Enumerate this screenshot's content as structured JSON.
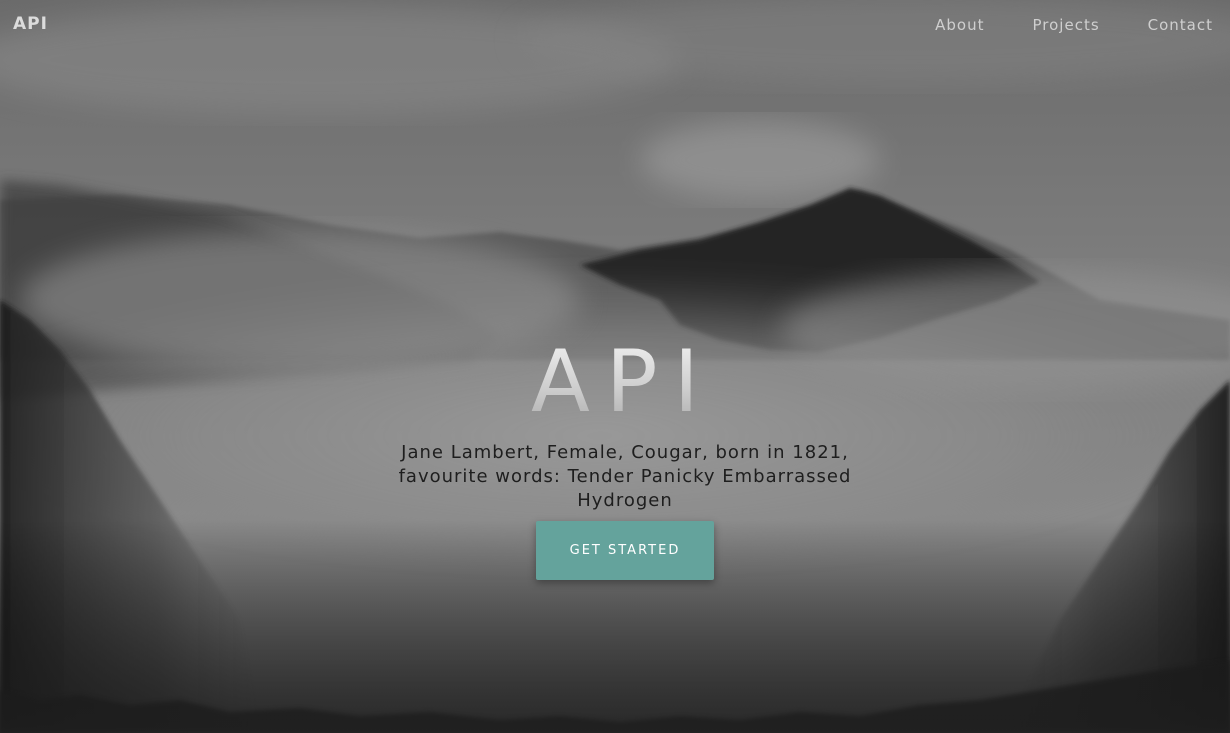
{
  "navbar": {
    "brand": "API",
    "links": [
      {
        "label": "About"
      },
      {
        "label": "Projects"
      },
      {
        "label": "Contact"
      }
    ]
  },
  "hero": {
    "title": "API",
    "subtitle": "Jane Lambert, Female, Cougar, born in 1821, favourite words: Tender Panicky Embarrassed Hydrogen",
    "cta_label": "GET STARTED",
    "background_image": "foggy-mountain-forest-image"
  },
  "colors": {
    "accent": "#64a39c",
    "nav_text": "#cfcfcf",
    "subtitle_text": "#1e1e1e"
  }
}
